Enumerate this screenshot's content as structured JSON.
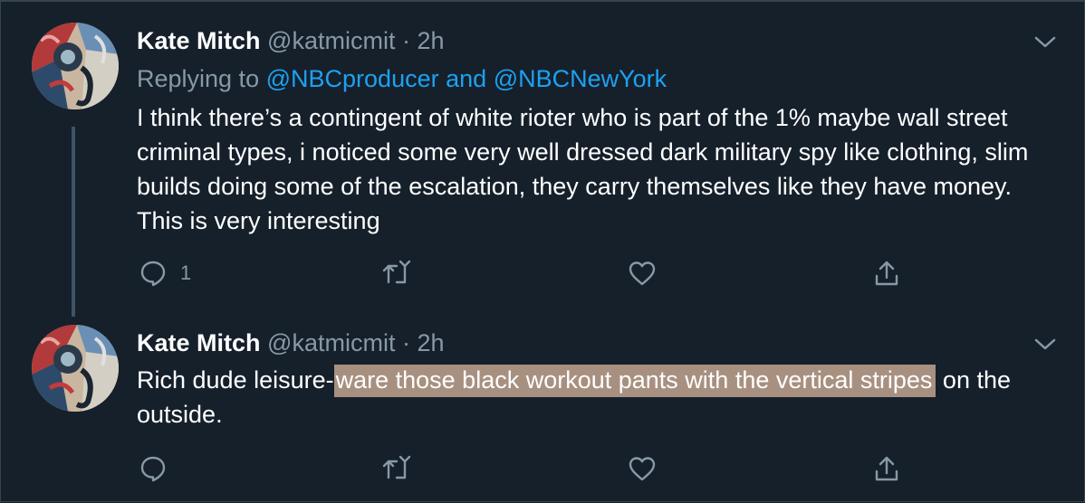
{
  "colors": {
    "background": "#15202b",
    "text": "#ffffff",
    "secondary_text": "#8899a6",
    "link": "#1da1f2",
    "thread_line": "#3d5466",
    "highlight": "#a89080"
  },
  "tweets": [
    {
      "author_name": "Kate Mitch",
      "handle": "@katmicmit",
      "separator": "·",
      "time": "2h",
      "replying_prefix": "Replying to",
      "reply_to_1": "@NBCproducer",
      "reply_to_and": "and",
      "reply_to_2": "@NBCNewYork",
      "body": "I think there’s a contingent of white rioter who is part of the 1% maybe wall street criminal types, i noticed some very well dressed dark military spy like clothing, slim builds doing some of the escalation, they carry themselves like they have money. This is very interesting",
      "reply_count": "1",
      "icons": [
        "avatar",
        "chevron-down-icon",
        "reply-icon",
        "retweet-icon",
        "like-icon",
        "share-icon"
      ]
    },
    {
      "author_name": "Kate Mitch",
      "handle": "@katmicmit",
      "separator": "·",
      "time": "2h",
      "body_before_highlight": "Rich dude leisure-",
      "body_highlight": "ware those black workout pants with the vertical stripes",
      "body_after_highlight": " on the outside.",
      "icons": [
        "avatar",
        "chevron-down-icon",
        "reply-icon",
        "retweet-icon",
        "like-icon",
        "share-icon"
      ]
    }
  ]
}
